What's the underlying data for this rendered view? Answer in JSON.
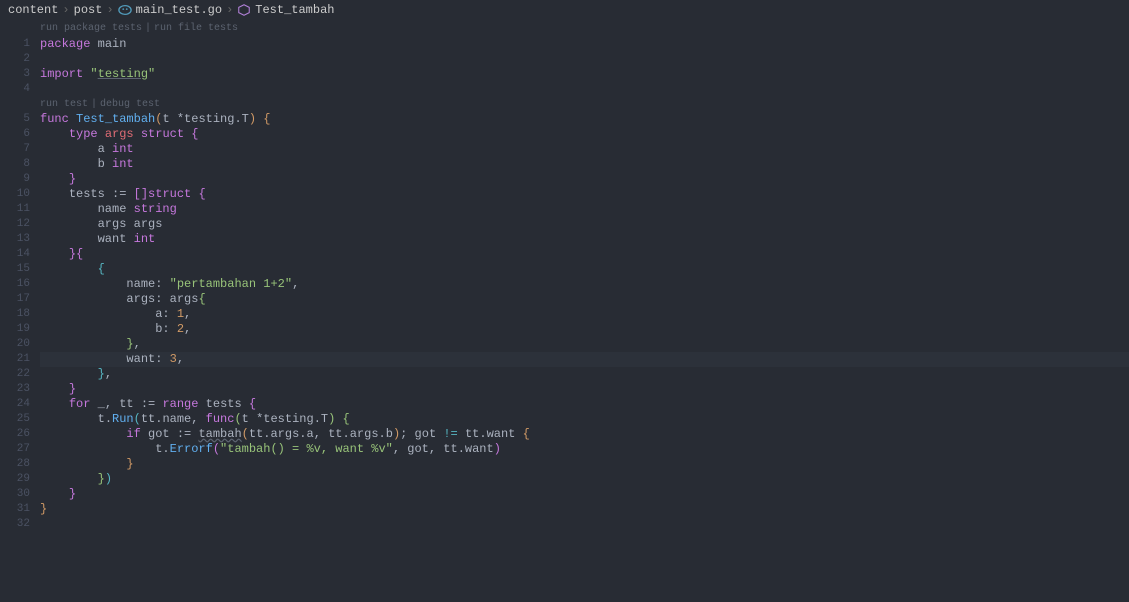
{
  "breadcrumb": {
    "items": [
      "content",
      "post",
      "main_test.go",
      "Test_tambah"
    ]
  },
  "codelens1": {
    "runPackage": "run package tests",
    "runFile": "run file tests"
  },
  "codelens2": {
    "runTest": "run test",
    "debugTest": "debug test"
  },
  "code": {
    "l1": {
      "kw": "package",
      "name": "main"
    },
    "l3": {
      "kw": "import",
      "q1": "\"",
      "str": "testing",
      "q2": "\""
    },
    "l5": {
      "kw": "func",
      "fn": "Test_tambah",
      "p1": "(",
      "p2": "t",
      "p3": "*",
      "p4": "testing",
      "dot": ".",
      "p5": "T",
      "p6": ")",
      "b": "{"
    },
    "l6": {
      "kw": "type",
      "name": "args",
      "struct": "struct",
      "b": "{"
    },
    "l7": {
      "name": "a",
      "typ": "int"
    },
    "l8": {
      "name": "b",
      "typ": "int"
    },
    "l9": {
      "b": "}"
    },
    "l10": {
      "name": "tests",
      "op": ":=",
      "b1": "[",
      "b2": "]",
      "struct": "struct",
      "b3": "{"
    },
    "l11": {
      "name": "name",
      "typ": "string"
    },
    "l12": {
      "name": "args",
      "typ": "args"
    },
    "l13": {
      "name": "want",
      "typ": "int"
    },
    "l14": {
      "b1": "}",
      "b2": "{"
    },
    "l15": {
      "b": "{"
    },
    "l16": {
      "name": "name:",
      "val": "\"pertambahan 1+2\"",
      "c": ","
    },
    "l17": {
      "name": "args:",
      "val": "args",
      "b": "{"
    },
    "l18": {
      "name": "a:",
      "val": "1",
      "c": ","
    },
    "l19": {
      "name": "b:",
      "val": "2",
      "c": ","
    },
    "l20": {
      "b": "}",
      "c": ","
    },
    "l21": {
      "name": "want:",
      "val": "3",
      "c": ","
    },
    "l22": {
      "b": "}",
      "c": ","
    },
    "l23": {
      "b": "}"
    },
    "l24": {
      "kw": "for",
      "u": "_",
      "c1": ",",
      "v": "tt",
      "op": ":=",
      "rng": "range",
      "arr": "tests",
      "b": "{"
    },
    "l25": {
      "t": "t",
      "d1": ".",
      "run": "Run",
      "p1": "(",
      "tt": "tt",
      "d2": ".",
      "nm": "name",
      "c": ",",
      "fn": "func",
      "p2": "(",
      "tp": "t",
      "st": "*",
      "tst": "testing",
      "d3": ".",
      "T": "T",
      "p3": ")",
      "b": "{"
    },
    "l26": {
      "kw": "if",
      "got": "got",
      "op": ":=",
      "fn": "tambah",
      "p1": "(",
      "tt1": "tt",
      "d1": ".",
      "a1": "args",
      "d2": ".",
      "a2": "a",
      "c1": ",",
      "tt2": "tt",
      "d3": ".",
      "a3": "args",
      "d4": ".",
      "a4": "b",
      "p2": ")",
      "sc": ";",
      "got2": "got",
      "ne": "!=",
      "tt3": "tt",
      "d5": ".",
      "w": "want",
      "b": "{"
    },
    "l27": {
      "t": "t",
      "d": ".",
      "e": "Errorf",
      "p1": "(",
      "str": "\"tambah() = %v, want %v\"",
      "c1": ",",
      "got": "got",
      "c2": ",",
      "tt": "tt",
      "d2": ".",
      "w": "want",
      "p2": ")"
    },
    "l28": {
      "b": "}"
    },
    "l29": {
      "b1": "}",
      "b2": ")"
    },
    "l30": {
      "b": "}"
    },
    "l31": {
      "b": "}"
    }
  }
}
